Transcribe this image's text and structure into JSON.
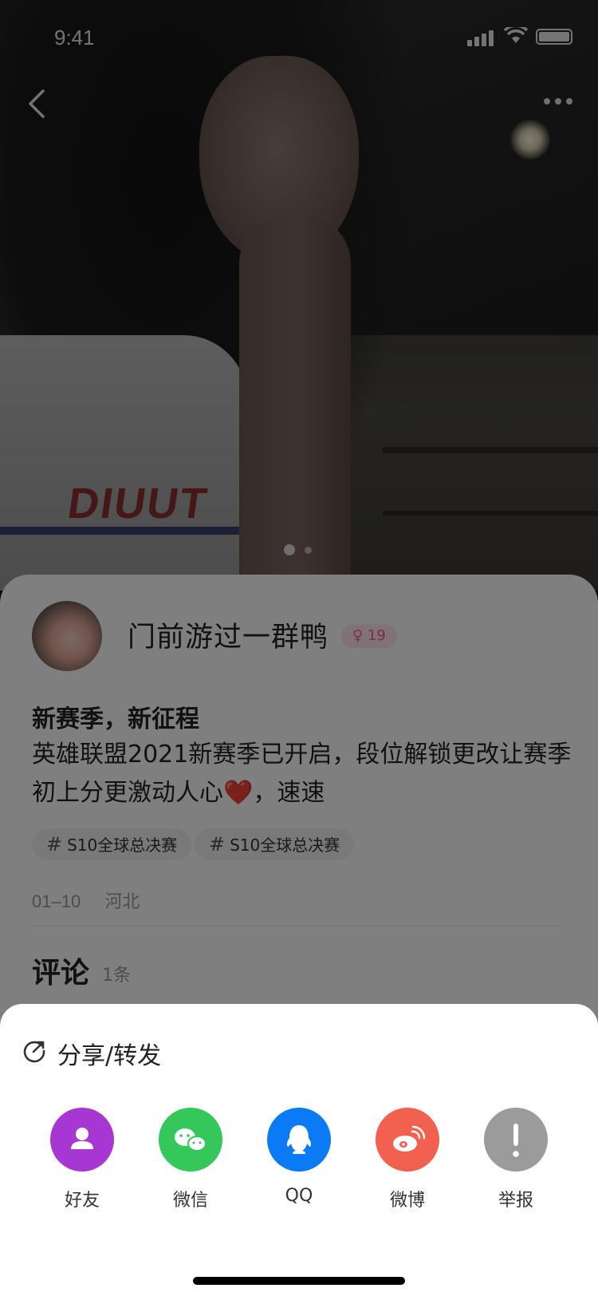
{
  "status_bar": {
    "time": "9:41"
  },
  "nav": {
    "back_icon": "chevron-left-icon",
    "more_icon": "more-horizontal-icon"
  },
  "photo": {
    "shirt_text": "DIUUT",
    "page_count": 2,
    "current_page": 1
  },
  "post": {
    "username": "门前游过一群鸭",
    "gender_age_badge": "♀ 19",
    "title": "新赛季，新征程",
    "body_before_emoji": "英雄联盟2021新赛季已开启，段位解锁更改让赛季初上分更激动人心",
    "emoji": "❤️",
    "body_after_emoji": "，速速",
    "tags": [
      "S10全球总决赛",
      "S10全球总决赛"
    ],
    "date": "01–10",
    "location": "河北"
  },
  "comments": {
    "title": "评论",
    "count": "1条"
  },
  "share_sheet": {
    "title": "分享/转发",
    "items": [
      {
        "label": "好友",
        "icon": "friend-icon",
        "color": "#A637D3"
      },
      {
        "label": "微信",
        "icon": "wechat-icon",
        "color": "#34C759"
      },
      {
        "label": "QQ",
        "icon": "qq-icon",
        "color": "#0A7BF4"
      },
      {
        "label": "微博",
        "icon": "weibo-icon",
        "color": "#F2614F"
      },
      {
        "label": "举报",
        "icon": "report-icon",
        "color": "#9B9B9B"
      }
    ]
  }
}
